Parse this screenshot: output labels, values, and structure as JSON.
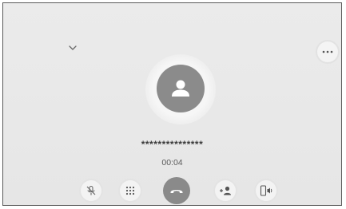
{
  "call": {
    "caller_number": "***************",
    "duration": "00:04"
  },
  "icons": {
    "collapse": "chevron-down-icon",
    "more": "more-horizontal-icon",
    "avatar": "person-icon",
    "mute": "microphone-muted-icon",
    "keypad": "dialpad-icon",
    "end_call": "hang-up-icon",
    "add_call": "add-contact-icon",
    "audio_source": "phone-speaker-icon"
  },
  "colors": {
    "background": "#e9e9e9",
    "end_call_button": "#8a8a8a",
    "avatar": "#8b8b8b"
  }
}
